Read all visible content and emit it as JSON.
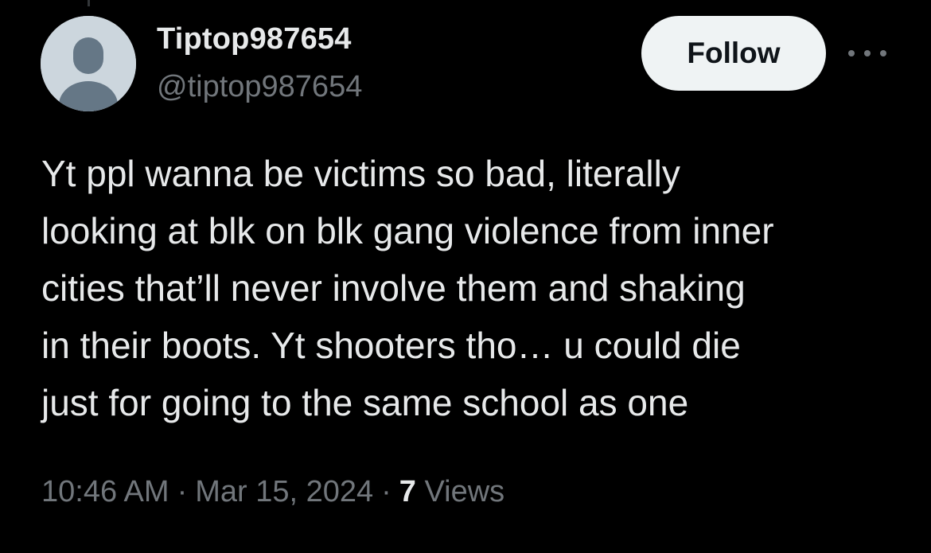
{
  "user": {
    "display_name": "Tiptop987654",
    "handle": "@tiptop987654"
  },
  "actions": {
    "follow_label": "Follow"
  },
  "tweet": {
    "text": "Yt ppl wanna be victims so bad, literally\nlooking at blk on blk gang violence from inner\ncities that’ll never involve them and shaking\nin their boots. Yt shooters tho… u could die\njust for going to the same school as one",
    "time": "10:46 AM",
    "separator": "·",
    "date": "Mar 15, 2024",
    "views_count": "7",
    "views_label": "Views"
  },
  "icons": {
    "avatar": "default-profile-icon",
    "more": "more-options-icon"
  },
  "colors": {
    "background": "#000000",
    "primary_text": "#e7e9ea",
    "secondary_text": "#71767b",
    "follow_button_bg": "#eff3f4",
    "follow_button_text": "#0f1419",
    "avatar_bg": "#ccd6dd",
    "avatar_figure": "#657786"
  }
}
